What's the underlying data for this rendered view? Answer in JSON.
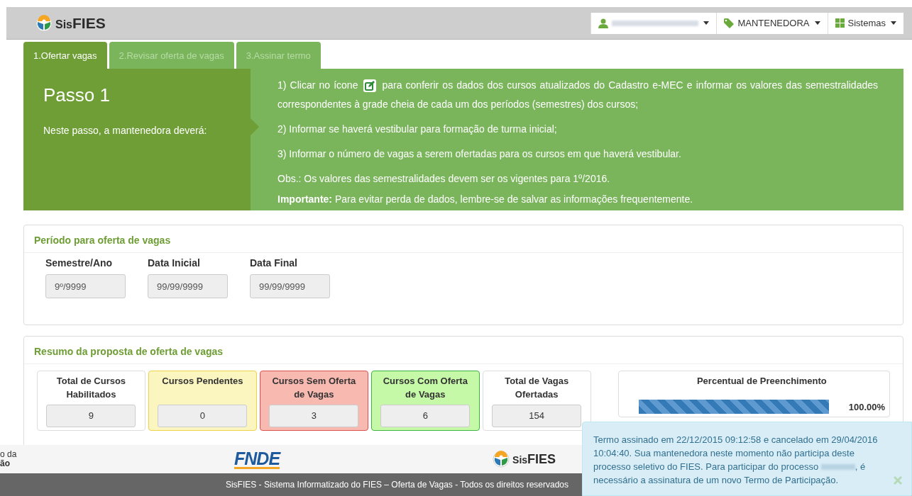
{
  "header": {
    "logo": {
      "prefix": "Sis",
      "name": "FIES"
    },
    "menus": [
      {
        "kind": "user"
      },
      {
        "kind": "tag",
        "label": "MANTENEDORA"
      },
      {
        "kind": "grid",
        "label": "Sistemas"
      }
    ]
  },
  "tabs": [
    {
      "label": "1.Ofertar vagas",
      "selected": true
    },
    {
      "label": "2.Revisar oferta de vagas",
      "selected": false
    },
    {
      "label": "3.Assinar termo",
      "selected": false
    }
  ],
  "step": {
    "title": "Passo 1",
    "intro": "Neste passo, a mantenedora deverá:",
    "instructions": [
      {
        "kind": "with_icon",
        "text": "1) Clicar no ícone",
        "text_after_icon": "para conferir os dados dos cursos atualizados do Cadastro e-MEC e informar os valores das semestralidades correspondentes à grade cheia de cada um dos períodos (semestres) dos cursos;"
      },
      {
        "kind": "plain",
        "text": "2) Informar se haverá vestibular para formação de turma inicial;"
      },
      {
        "kind": "plain",
        "text": "3) Informar o número de vagas a serem ofertadas para os cursos em que haverá vestibular."
      },
      {
        "kind": "note",
        "text": "Obs.: Os valores das semestralidades devem ser os vigentes para 1º/2016."
      },
      {
        "kind": "note",
        "text": "**Importante:** Para evitar perda de dados, lembre-se de salvar as informações frequentemente."
      }
    ]
  },
  "period": {
    "title": "Período para oferta de vagas",
    "fields": [
      {
        "label": "Semestre/Ano",
        "placeholder": "9º/9999"
      },
      {
        "label": "Data Inicial",
        "placeholder": "99/99/9999"
      },
      {
        "label": "Data Final",
        "placeholder": "99/99/9999"
      }
    ]
  },
  "summary": {
    "title": "Resumo da proposta de oferta de vagas",
    "cards": [
      {
        "kind": "neutral",
        "label": "Total de Cursos Habilitados",
        "value": "9"
      },
      {
        "kind": "pending",
        "label": "Cursos Pendentes",
        "value": "0"
      },
      {
        "kind": "danger",
        "label": "Cursos Sem Oferta de Vagas",
        "value": "3"
      },
      {
        "kind": "success",
        "label": "Cursos Com Oferta de Vagas",
        "value": "6"
      },
      {
        "kind": "neutral",
        "label": "Total de Vagas Ofertadas",
        "value": "154"
      }
    ],
    "progress": {
      "label": "Percentual de Preenchimento",
      "level": 1,
      "reading": "100.00%"
    }
  },
  "footer": {
    "partial_lines": [
      "o da",
      "ão"
    ],
    "fnde_logo": "FNDE",
    "logo": {
      "prefix": "Sis",
      "name": "FIES"
    },
    "copyright": "SisFIES - Sistema Informatizado do FIES – Oferta de Vagas - Todos os direitos reservados"
  },
  "notice": {
    "text_before": "Termo assinado em 22/12/2015 09:12:58 e cancelado em 29/04/2016 10:04:40. Sua mantenedora neste momento não participa deste processo seletivo do FIES. Para participar do processo",
    "text_after": ", é necessário a assinatura de um novo Termo de Participação."
  }
}
